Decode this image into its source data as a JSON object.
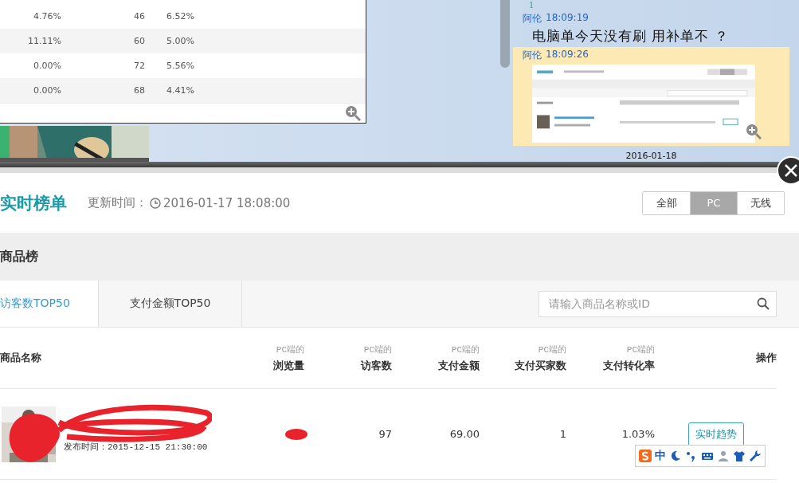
{
  "background_table": {
    "rows": [
      {
        "cells": [
          "4.76%",
          "46",
          "6.52%"
        ]
      },
      {
        "cells": [
          "11.11%",
          "60",
          "5.00%"
        ]
      },
      {
        "cells": [
          "0.00%",
          "72",
          "5.56%"
        ]
      },
      {
        "cells": [
          "0.00%",
          "68",
          "4.41%"
        ]
      }
    ]
  },
  "chat": {
    "partial_line": "1",
    "messages": [
      {
        "kind": "text",
        "sender": "阿伦",
        "time": "18:09:19",
        "text": "电脑单今天没有刷 用补单不 ？",
        "selected": false
      },
      {
        "sender": "阿伦",
        "time": "18:09:26",
        "selected": true
      }
    ],
    "date": "2016-01-18"
  },
  "modal": {
    "title": "实时榜单",
    "update_label": "更新时间：",
    "update_time": "2016-01-17 18:08:00",
    "segments": [
      {
        "label": "全部",
        "selected": false
      },
      {
        "label": "PC",
        "selected": true
      },
      {
        "label": "无线",
        "selected": false
      }
    ],
    "section": "商品榜",
    "tabs": [
      {
        "label": "访客数TOP50",
        "selected": true
      },
      {
        "label": "支付金额TOP50",
        "selected": false
      }
    ],
    "search": {
      "placeholder": "请输入商品名称或ID"
    },
    "table": {
      "columns": [
        {
          "label": "商品名称"
        },
        {
          "caption": "PC端的",
          "label": "浏览量"
        },
        {
          "caption": "PC端的",
          "label": "访客数"
        },
        {
          "caption": "PC端的",
          "label": "支付金额"
        },
        {
          "caption": "PC端的",
          "label": "支付买家数"
        },
        {
          "caption": "PC端的",
          "label": "支付转化率"
        },
        {
          "label": "操作"
        }
      ],
      "rows": [
        {
          "cells": [
            {
              "kind": "product",
              "text": "发布时间：2015-12-15 21:30:00"
            },
            {
              "kind": "redacted"
            },
            {
              "kind": "number",
              "text": "97"
            },
            {
              "kind": "number",
              "text": "69.00"
            },
            {
              "kind": "number",
              "text": "1"
            },
            {
              "kind": "number",
              "text": "1.03%"
            },
            {
              "kind": "button",
              "text": "实时趋势"
            }
          ]
        }
      ]
    }
  },
  "ime_toolbar": {
    "mode": "中"
  }
}
